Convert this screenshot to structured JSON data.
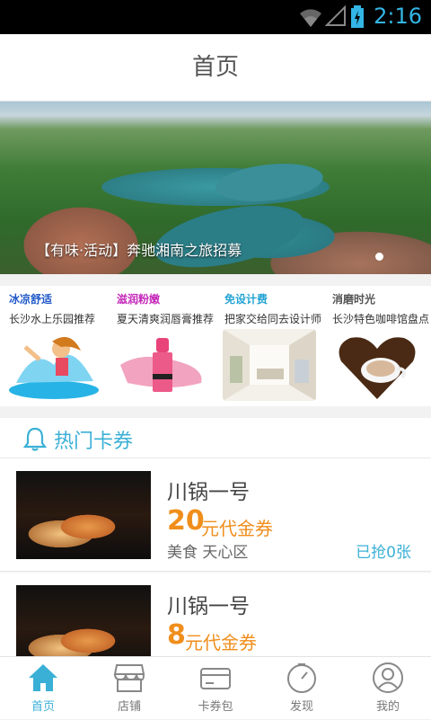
{
  "statusbar": {
    "time": "2:16"
  },
  "header": {
    "title": "首页"
  },
  "banner": {
    "caption": "【有味·活动】奔驰湘南之旅招募",
    "active_dot": 1,
    "dots": 1
  },
  "promos": [
    {
      "title": "冰凉舒适",
      "subtitle": "长沙水上乐园推荐",
      "title_color": "#1f58c8"
    },
    {
      "title": "滋润粉嫩",
      "subtitle": "夏天清爽润唇膏推荐",
      "title_color": "#c427b8"
    },
    {
      "title": "免设计费",
      "subtitle": "把家交给同去设计师",
      "title_color": "#24a4d4"
    },
    {
      "title": "消磨时光",
      "subtitle": "长沙特色咖啡馆盘点",
      "title_color": "#555555"
    }
  ],
  "section": {
    "title": "热门卡券"
  },
  "coupons": [
    {
      "name": "川锅一号",
      "amount": "20",
      "unit": "元代金券",
      "meta": "美食 天心区",
      "taken": "已抢0张"
    },
    {
      "name": "川锅一号",
      "amount": "8",
      "unit": "元代金券",
      "meta": "",
      "taken": ""
    }
  ],
  "tabs": [
    {
      "label": "首页",
      "icon": "home-icon",
      "active": true
    },
    {
      "label": "店铺",
      "icon": "shop-icon",
      "active": false
    },
    {
      "label": "卡券包",
      "icon": "card-icon",
      "active": false
    },
    {
      "label": "发现",
      "icon": "compass-icon",
      "active": false
    },
    {
      "label": "我的",
      "icon": "user-icon",
      "active": false
    }
  ],
  "colors": {
    "accent": "#3bb0d6",
    "price": "#f08e1c"
  }
}
